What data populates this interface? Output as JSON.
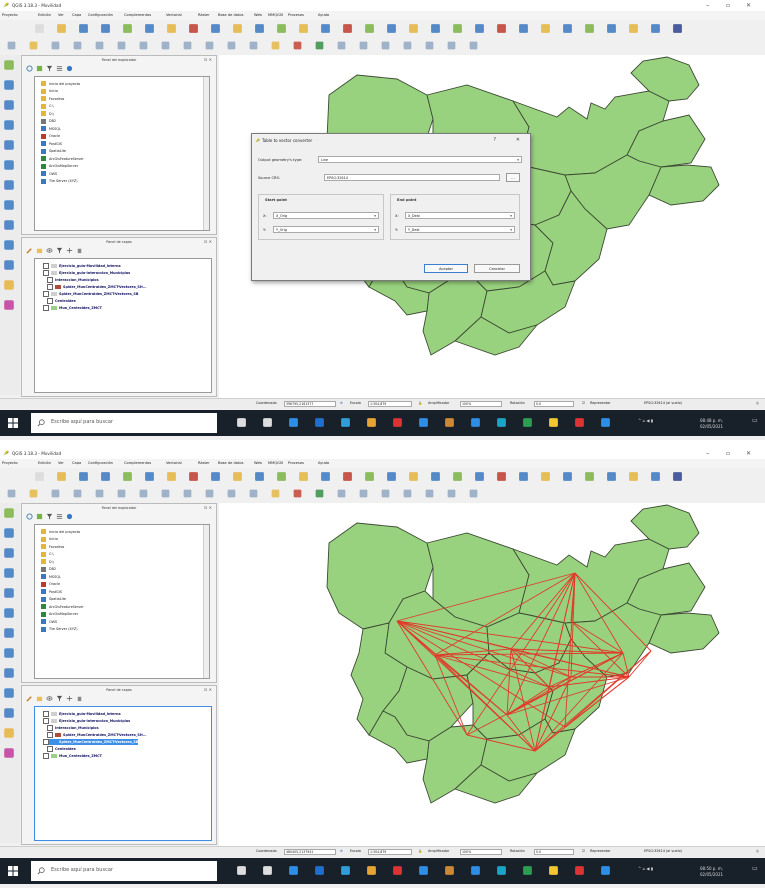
{
  "colors": {
    "polygon_fill": "#99d27e",
    "polygon_stroke": "#3c4a34",
    "spider_lines": "#e03a2a",
    "selection": "#3d8fe8",
    "taskbar": "#18202a"
  },
  "shots": [
    {
      "window_title": "QGIS 3.18.3 - Movilidad",
      "menu": [
        "Proyecto",
        "Edición",
        "Ver",
        "Capa",
        "Configuración",
        "Complementos",
        "Vectorial",
        "Ráster",
        "Base de datos",
        "Web",
        "MMQGIS",
        "Procesos",
        "Ayuda"
      ],
      "browser_panel": {
        "title": "Panel del explorador",
        "items": [
          "Inicio del proyecto",
          "Inicio",
          "Favoritos",
          "C:\\",
          "D:\\",
          "DB2",
          "MSSQL",
          "Oracle",
          "PostGIS",
          "SpatiaLite",
          "ArcGisFeatureServer",
          "ArcGisMapServer",
          "OWS",
          "Tile Server (XYZ)"
        ]
      },
      "layers_panel": {
        "title": "Panel de capas",
        "layers": [
          {
            "name": "Ejercicio_guia-Movilidad_Interna",
            "indent": 8,
            "swatch": "#cfcfcf"
          },
          {
            "name": "Ejercicio_guia-Interaccion_Municipios",
            "indent": 8,
            "swatch": "#cfcfcf"
          },
          {
            "name": "Interaccion_Municipios",
            "indent": 12,
            "swatch": ""
          },
          {
            "name": "Spider_MunCentroides_ZMCT-Vectores_SH...",
            "indent": 12,
            "swatch": "#b04a3a"
          },
          {
            "name": "Spider_MunCentroides_ZMCT-Vectores_SB",
            "indent": 8,
            "swatch": "#cfcfcf"
          },
          {
            "name": "Centroides",
            "indent": 12,
            "swatch": ""
          },
          {
            "name": "Mun_Centroides_ZMCT",
            "indent": 8,
            "swatch": "#99d27e"
          }
        ],
        "selected_index": -1
      },
      "dialog": {
        "visible": true,
        "title": "Table to vector converter",
        "help": "?",
        "close": "✕",
        "geometry_label": "Output geometry's type:",
        "geometry_value": "Line",
        "crs_label": "Source CRS:",
        "crs_value": "EPSG:32614",
        "crs_button": "...",
        "start_title": "Start point",
        "start_x_label": "X:",
        "start_x_value": "X_Orig",
        "start_y_label": "Y:",
        "start_y_value": "Y_Orig",
        "end_title": "End point",
        "end_x_label": "X:",
        "end_x_value": "X_Dest",
        "end_y_label": "Y:",
        "end_y_value": "Y_Dest",
        "accept": "Aceptar",
        "cancel": "Cancelar"
      },
      "spider_visible": false,
      "status": {
        "coord_label": "Coordenada",
        "coord_value": "396795,2161377",
        "scale_label": "Escala",
        "scale_value": "1:304,879",
        "magnifier_label": "Amplificador",
        "magnifier_value": "100%",
        "rotation_label": "Rotación",
        "rotation_value": "0.0",
        "render_label": "Representar",
        "crs": "EPSG:32614 (al vuelo)"
      },
      "taskbar": {
        "search_placeholder": "Escribe aquí para buscar",
        "time": "08:48 p. m.",
        "date": "02/05/2021"
      }
    },
    {
      "window_title": "QGIS 3.18.3 - Movilidad",
      "menu": [
        "Proyecto",
        "Edición",
        "Ver",
        "Capa",
        "Configuración",
        "Complementos",
        "Vectorial",
        "Ráster",
        "Base de datos",
        "Web",
        "MMQGIS",
        "Procesos",
        "Ayuda"
      ],
      "browser_panel": {
        "title": "Panel del explorador",
        "items": [
          "Inicio del proyecto",
          "Inicio",
          "Favoritos",
          "C:\\",
          "D:\\",
          "DB2",
          "MSSQL",
          "Oracle",
          "PostGIS",
          "SpatiaLite",
          "ArcGisFeatureServer",
          "ArcGisMapServer",
          "OWS",
          "Tile Server (XYZ)"
        ]
      },
      "layers_panel": {
        "title": "Panel de capas",
        "layers": [
          {
            "name": "Ejercicio_guia-Movilidad_Interna",
            "indent": 8,
            "swatch": "#cfcfcf"
          },
          {
            "name": "Ejercicio_guia-Interaccion_Municipios",
            "indent": 8,
            "swatch": "#cfcfcf"
          },
          {
            "name": "Interaccion_Municipios",
            "indent": 12,
            "swatch": ""
          },
          {
            "name": "Spider_MunCentroides_ZMCT-Vectores_SH...",
            "indent": 12,
            "swatch": "#b04a3a"
          },
          {
            "name": "Spider_MunCentroides_ZMCT-Vectores_SB",
            "indent": 8,
            "swatch": "#3d8fe8"
          },
          {
            "name": "Centroides",
            "indent": 12,
            "swatch": ""
          },
          {
            "name": "Mun_Centroides_ZMCT",
            "indent": 8,
            "swatch": "#99d27e"
          }
        ],
        "selected_index": 4
      },
      "dialog": {
        "visible": false
      },
      "spider_visible": true,
      "status": {
        "coord_label": "Coordenada",
        "coord_value": "460405,2137941",
        "scale_label": "Escala",
        "scale_value": "1:304,879",
        "magnifier_label": "Amplificador",
        "magnifier_value": "100%",
        "rotation_label": "Rotación",
        "rotation_value": "0.0",
        "render_label": "Representar",
        "crs": "EPSG:32614 (al vuelo)"
      },
      "taskbar": {
        "search_placeholder": "Escribe aquí para buscar",
        "time": "08:50 p. m.",
        "date": "02/05/2021"
      }
    }
  ]
}
